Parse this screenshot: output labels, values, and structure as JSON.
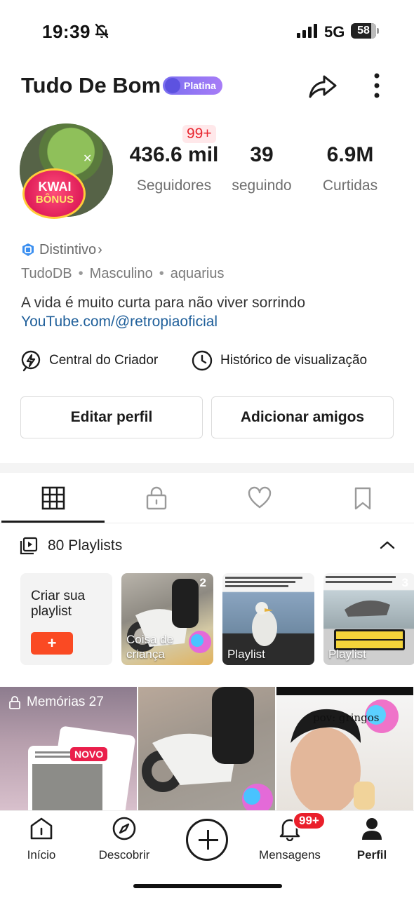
{
  "status_bar": {
    "time": "19:39",
    "network": "5G",
    "battery": "58"
  },
  "profile": {
    "name": "Tudo De Bom",
    "badge": "Platina",
    "notification_count": "99+",
    "stats": [
      {
        "value": "436.6 mil",
        "label": "Seguidores"
      },
      {
        "value": "39",
        "label": "seguindo"
      },
      {
        "value": "6.9M",
        "label": "Curtidas"
      }
    ],
    "avatar_promo": {
      "line1": "KWAI",
      "line2": "BÔNUS"
    },
    "distintivo": "Distintivo",
    "handle": "TudoDB",
    "gender": "Masculino",
    "sign": "aquarius",
    "bio": "A vida é muito curta para não viver sorrindo",
    "link": "YouTube.com/@retropiaoficial"
  },
  "shortcuts": {
    "creator": "Central do Criador",
    "history": "Histórico de visualização"
  },
  "actions": {
    "edit": "Editar perfil",
    "add_friends": "Adicionar amigos"
  },
  "tabs": [
    {
      "icon": "grid-icon",
      "active": true
    },
    {
      "icon": "lock-icon",
      "active": false
    },
    {
      "icon": "heart-icon",
      "active": false
    },
    {
      "icon": "bookmark-icon",
      "active": false
    }
  ],
  "playlists": {
    "header": "80 Playlists",
    "create_label": "Criar sua playlist",
    "create_button": "+",
    "items": [
      {
        "label": "Coisa de criança",
        "count": "2"
      },
      {
        "label": "Playlist",
        "count": ""
      },
      {
        "label": "Playlist",
        "count": "3"
      }
    ]
  },
  "grid": {
    "memories": "Memórias 27",
    "new_badge": "NOVO",
    "overlay_text": "pov: gringos"
  },
  "bottom_nav": {
    "home": "Início",
    "discover": "Descobrir",
    "messages": "Mensagens",
    "messages_badge": "99+",
    "profile": "Perfil"
  },
  "colors": {
    "accent": "#fa4a23",
    "badge_red": "#ea1f2b",
    "link": "#1f5f9a",
    "platina": "#8a77f4"
  }
}
